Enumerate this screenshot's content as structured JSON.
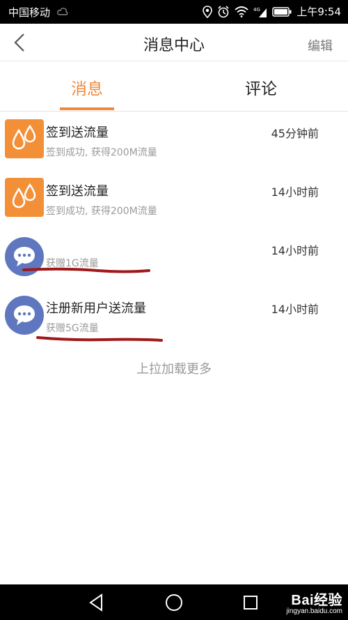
{
  "status_bar": {
    "carrier": "中国移动",
    "time": "上午9:54",
    "icons": [
      "cloud-icon",
      "location-icon",
      "alarm-icon",
      "wifi-icon",
      "signal-icon",
      "battery-icon"
    ]
  },
  "header": {
    "title": "消息中心",
    "edit_label": "编辑",
    "back_icon": "chevron-left-icon"
  },
  "tabs": [
    {
      "label": "消息",
      "active": true
    },
    {
      "label": "评论",
      "active": false
    }
  ],
  "messages": [
    {
      "icon": "droplet-icon",
      "icon_color": "#f38f37",
      "title": "签到送流量",
      "subtitle": "签到成功, 获得200M流量",
      "time": "45分钟前"
    },
    {
      "icon": "droplet-icon",
      "icon_color": "#f38f37",
      "title": "签到送流量",
      "subtitle": "签到成功, 获得200M流量",
      "time": "14小时前"
    },
    {
      "icon": "chat-bubble-icon",
      "icon_color": "#5f77bf",
      "title": "",
      "subtitle": "获赠1G流量",
      "time": "14小时前"
    },
    {
      "icon": "chat-bubble-icon",
      "icon_color": "#5f77bf",
      "title": "注册新用户送流量",
      "subtitle": "获赠5G流量",
      "time": "14小时前"
    }
  ],
  "load_more": "上拉加载更多",
  "nav_bar": {
    "buttons": [
      "back-triangle-icon",
      "home-circle-icon",
      "recents-square-icon"
    ]
  },
  "watermark": {
    "logo": "Bai经验",
    "url": "jingyan.baidu.com"
  },
  "colors": {
    "accent": "#f0893a",
    "annotation": "#a01818"
  }
}
